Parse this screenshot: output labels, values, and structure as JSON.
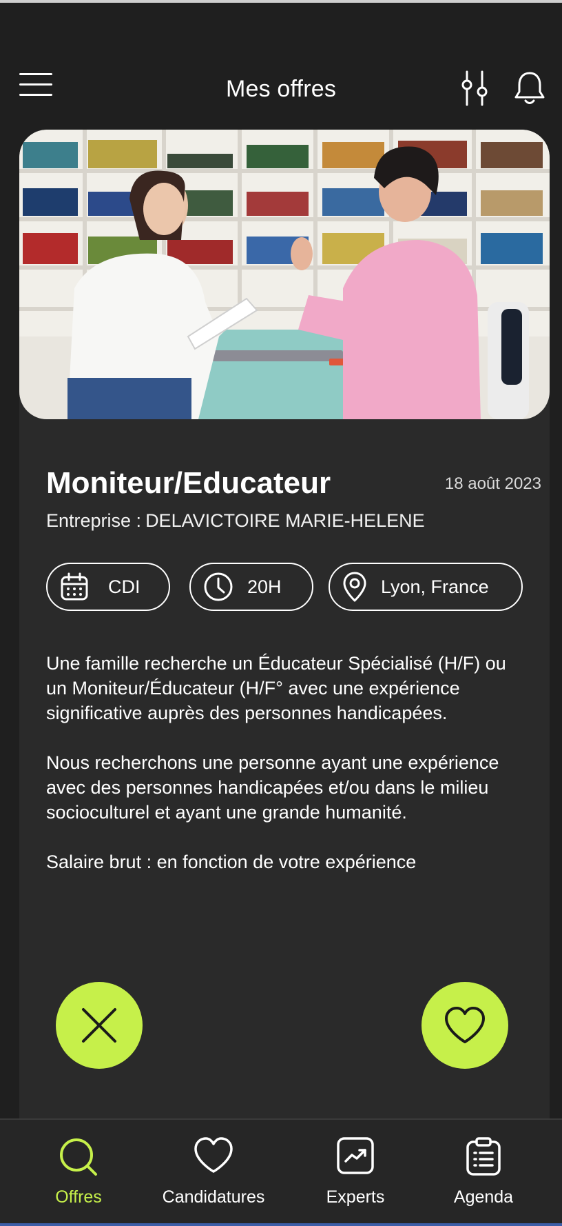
{
  "header": {
    "title": "Mes offres"
  },
  "offer": {
    "title": "Moniteur/Educateur",
    "date": "18 août 2023",
    "company_label": "Entreprise :",
    "company_name": "DELAVICTOIRE MARIE-HELENE",
    "contract": "CDI",
    "hours": "20H",
    "location": "Lyon, France",
    "description": [
      "Une famille recherche un Éducateur Spécialisé (H/F) ou un Moniteur/Éducateur (H/F° avec une expérience significative auprès des personnes handicapées.",
      "Nous recherchons une personne ayant une expérience avec des personnes handicapées et/ou dans le milieu socioculturel et ayant une grande humanité.",
      "Salaire brut : en fonction de votre expérience"
    ]
  },
  "tabs": [
    {
      "label": "Offres",
      "icon": "search-icon",
      "active": true
    },
    {
      "label": "Candidatures",
      "icon": "heart-icon",
      "active": false
    },
    {
      "label": "Experts",
      "icon": "trending-chart-icon",
      "active": false
    },
    {
      "label": "Agenda",
      "icon": "clipboard-list-icon",
      "active": false
    }
  ],
  "colors": {
    "accent": "#c6f04a",
    "background": "#1f1f1f",
    "card": "#2a2a2a"
  }
}
